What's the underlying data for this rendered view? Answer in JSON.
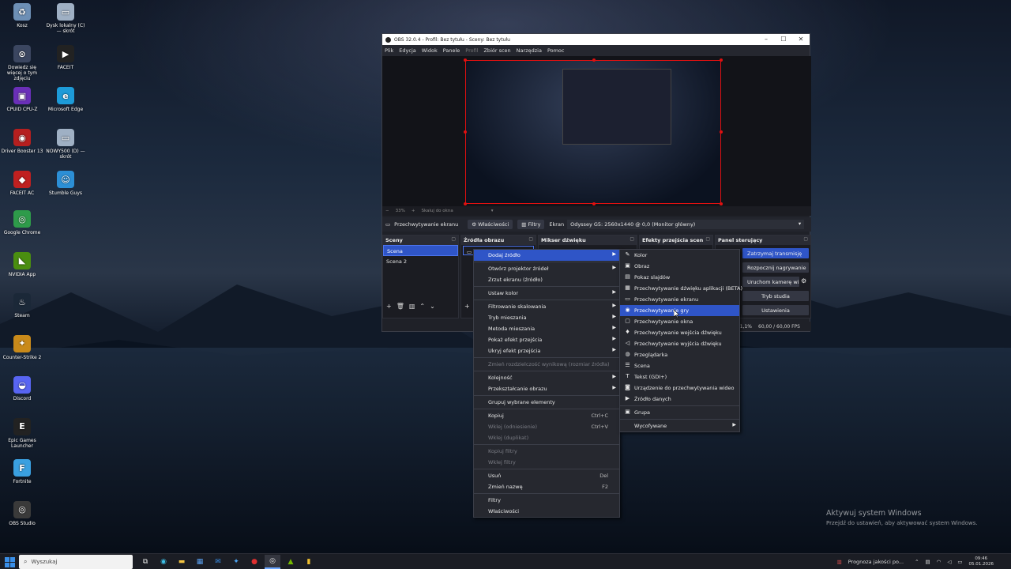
{
  "desktop_icons": [
    {
      "label": "Kosz",
      "icon": "recycle-bin-icon"
    },
    {
      "label": "Dysk lokalny (C) — skrót",
      "icon": "drive-icon"
    },
    {
      "label": "Dowiedz się więcej o tym zdjęciu",
      "icon": "info-icon"
    },
    {
      "label": "FACEIT",
      "icon": "faceit-icon"
    },
    {
      "label": "CPUID CPU-Z",
      "icon": "cpuz-icon"
    },
    {
      "label": "Microsoft Edge",
      "icon": "edge-icon"
    },
    {
      "label": "Driver Booster 13",
      "icon": "driver-booster-icon"
    },
    {
      "label": "NOWY500 (D) — skrót",
      "icon": "drive-icon"
    },
    {
      "label": "FACEIT AC",
      "icon": "faceit-ac-icon"
    },
    {
      "label": "Stumble Guys",
      "icon": "stumble-guys-icon"
    },
    {
      "label": "Google Chrome",
      "icon": "chrome-icon"
    },
    {
      "label": "NVIDIA App",
      "icon": "nvidia-icon"
    },
    {
      "label": "Steam",
      "icon": "steam-icon"
    },
    {
      "label": "Counter-Strike 2",
      "icon": "cs2-icon"
    },
    {
      "label": "Discord",
      "icon": "discord-icon"
    },
    {
      "label": "Epic Games Launcher",
      "icon": "epic-icon"
    },
    {
      "label": "Fortnite",
      "icon": "fortnite-icon"
    },
    {
      "label": "OBS Studio",
      "icon": "obs-icon"
    }
  ],
  "obs": {
    "title": "OBS 32.0.4 - Profil: Bez tytułu - Sceny: Bez tytułu",
    "menu": [
      "Plik",
      "Edycja",
      "Widok",
      "Panele",
      "Profil",
      "Zbiór scen",
      "Narzędzia",
      "Pomoc"
    ],
    "zoom": {
      "minus": "−",
      "value": "33%",
      "plus": "+",
      "mode": "Skaluj do okna"
    },
    "source_toolbar": {
      "source_name": "Przechwytywanie ekranu",
      "properties": "Właściwości",
      "filters": "Filtry",
      "screen_label": "Ekran",
      "screen_value": "Odyssey G5: 2560x1440 @ 0,0 (Monitor główny)"
    },
    "docks": {
      "scenes": {
        "title": "Sceny",
        "items": [
          "Scena",
          "Scena 2"
        ]
      },
      "sources": {
        "title": "Źródła obrazu"
      },
      "mixer": {
        "title": "Mikser dźwięku"
      },
      "transitions": {
        "title": "Efekty przejścia scen"
      },
      "controls": {
        "title": "Panel sterujący",
        "buttons": [
          "Zatrzymaj transmisję",
          "Rozpocznij nagrywanie",
          "Uruchom kamerę wirtualną",
          "Tryb studia",
          "Ustawienia"
        ]
      }
    },
    "status": {
      "cpu": "1,1%",
      "fps": "60,00 / 60,00 FPS"
    }
  },
  "context_menu": {
    "items": [
      {
        "label": "Dodaj źródło",
        "arrow": true,
        "highlight": true
      },
      {
        "label": "Otwórz projektor źródeł",
        "arrow": true
      },
      {
        "label": "Zrzut ekranu (źródło)"
      },
      {
        "label": "Ustaw kolor",
        "arrow": true
      },
      {
        "label": "Filtrowanie skalowania",
        "arrow": true
      },
      {
        "label": "Tryb mieszania",
        "arrow": true
      },
      {
        "label": "Metoda mieszania",
        "arrow": true
      },
      {
        "label": "Pokaż efekt przejścia",
        "arrow": true
      },
      {
        "label": "Ukryj efekt przejścia",
        "arrow": true
      },
      {
        "label": "Zmień rozdzielczość wynikową (rozmiar źródła)",
        "disabled": true
      },
      {
        "label": "Kolejność",
        "arrow": true
      },
      {
        "label": "Przekształcanie obrazu",
        "arrow": true
      },
      {
        "label": "Grupuj wybrane elementy"
      },
      {
        "label": "Kopiuj",
        "shortcut": "Ctrl+C"
      },
      {
        "label": "Wklej (odniesienie)",
        "shortcut": "Ctrl+V",
        "disabled": true
      },
      {
        "label": "Wklej (duplikat)",
        "disabled": true
      },
      {
        "label": "Kopiuj filtry",
        "disabled": true
      },
      {
        "label": "Wklej filtry",
        "disabled": true
      },
      {
        "label": "Usuń",
        "shortcut": "Del"
      },
      {
        "label": "Zmień nazwę",
        "shortcut": "F2"
      },
      {
        "label": "Filtry"
      },
      {
        "label": "Właściwości"
      }
    ]
  },
  "add_source_menu": {
    "items": [
      {
        "label": "Kolor",
        "icon": "brush-icon"
      },
      {
        "label": "Obraz",
        "icon": "image-icon"
      },
      {
        "label": "Pokaz slajdów",
        "icon": "slideshow-icon"
      },
      {
        "label": "Przechwytywanie dźwięku aplikacji (BETA)",
        "icon": "app-audio-icon"
      },
      {
        "label": "Przechwytywanie ekranu",
        "icon": "monitor-icon"
      },
      {
        "label": "Przechwytywanie gry",
        "icon": "gamepad-icon",
        "highlight": true
      },
      {
        "label": "Przechwytywanie okna",
        "icon": "window-icon"
      },
      {
        "label": "Przechwytywanie wejścia dźwięku",
        "icon": "microphone-icon"
      },
      {
        "label": "Przechwytywanie wyjścia dźwięku",
        "icon": "speaker-icon"
      },
      {
        "label": "Przeglądarka",
        "icon": "globe-icon"
      },
      {
        "label": "Scena",
        "icon": "scene-icon"
      },
      {
        "label": "Tekst (GDI+)",
        "icon": "text-icon"
      },
      {
        "label": "Urządzenie do przechwytywania wideo",
        "icon": "camera-icon"
      },
      {
        "label": "Źródło danych",
        "icon": "play-icon"
      },
      {
        "label": "Grupa",
        "icon": "group-icon"
      },
      {
        "label": "Wycofywane",
        "arrow": true
      }
    ]
  },
  "watermark": {
    "line1": "Aktywuj system Windows",
    "line2": "Przejdź do ustawień, aby aktywować system Windows."
  },
  "taskbar": {
    "search_placeholder": "Wyszukaj",
    "weather": "Prognoza jakości po...",
    "time": "09:46",
    "date": "05.01.2026"
  }
}
